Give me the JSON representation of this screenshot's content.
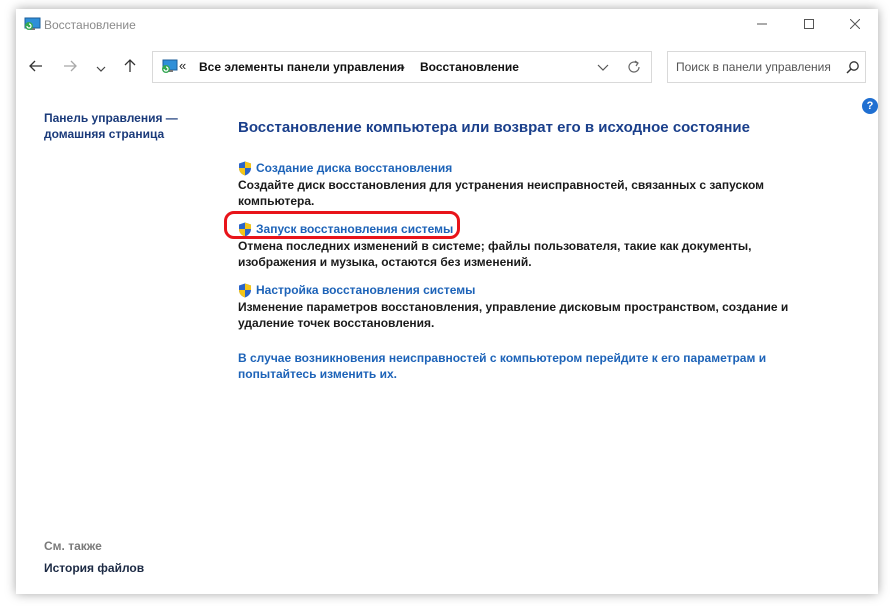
{
  "window": {
    "title": "Восстановление",
    "controls": {
      "minimize_icon": "minimize-icon",
      "maximize_icon": "maximize-icon",
      "close_icon": "close-icon"
    }
  },
  "nav": {
    "back_icon": "arrow-left-icon",
    "forward_icon": "arrow-right-icon",
    "recent_icon": "chevron-down-icon",
    "up_icon": "arrow-up-icon"
  },
  "address": {
    "overflow": "«",
    "crumbs": [
      "Все элементы панели управления",
      "Восстановление"
    ],
    "separator": "›"
  },
  "search": {
    "placeholder": "Поиск в панели управления"
  },
  "left": {
    "home_link": "Панель управления — домашняя страница",
    "see_also": "См. также",
    "file_history": "История файлов"
  },
  "main": {
    "heading": "Восстановление компьютера или возврат его в исходное состояние",
    "tasks": [
      {
        "label": "Создание диска восстановления",
        "description": "Создайте диск восстановления для устранения неисправностей, связанных с запуском компьютера."
      },
      {
        "label": "Запуск восстановления системы",
        "description": "Отмена последних изменений в системе; файлы пользователя, такие как документы, изображения и музыка, остаются без изменений."
      },
      {
        "label": "Настройка восстановления системы",
        "description": "Изменение параметров восстановления, управление дисковым пространством, создание и удаление точек восстановления."
      }
    ],
    "bottom_link": "В случае возникновения неисправностей с компьютером перейдите к его параметрам и попытайтесь изменить их."
  },
  "colors": {
    "link": "#1d63b8",
    "heading": "#1a3f8b",
    "highlight": "#e8141a",
    "help": "#1f6fd1"
  }
}
